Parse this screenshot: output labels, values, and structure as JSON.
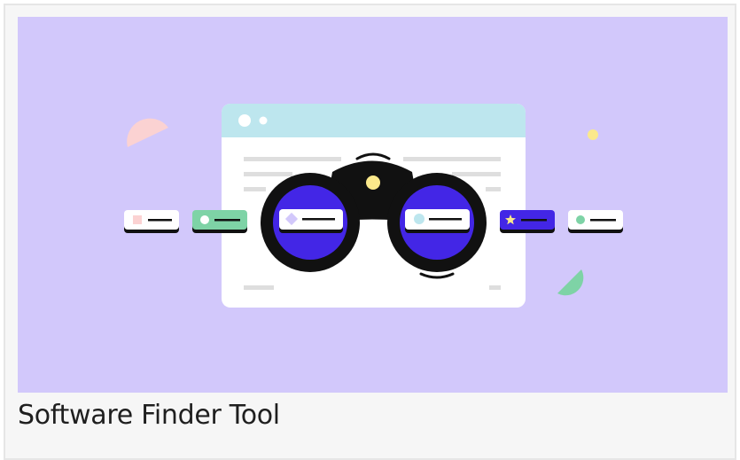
{
  "card": {
    "title": "Software Finder Tool"
  },
  "illustration": {
    "subject": "binoculars-over-browser-window",
    "colors": {
      "background": "#d2c8fb",
      "window_header": "#bde6ee",
      "window_body": "#ffffff",
      "lens_fill": "#4326e6",
      "green_accent": "#7ed3a6",
      "yellow_accent": "#fbe98b",
      "pink_accent": "#fbd2d2",
      "outline": "#111111"
    }
  }
}
